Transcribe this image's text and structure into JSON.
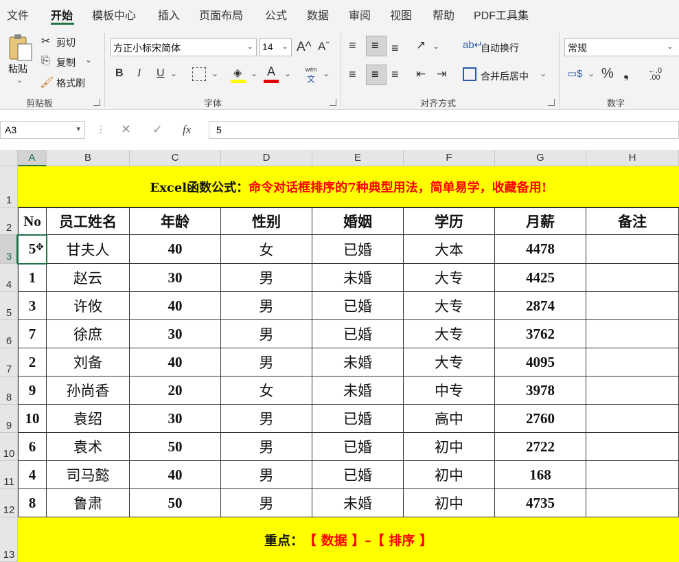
{
  "menu": {
    "tabs": [
      "文件",
      "开始",
      "模板中心",
      "插入",
      "页面布局",
      "公式",
      "数据",
      "审阅",
      "视图",
      "帮助",
      "PDF工具集"
    ]
  },
  "clipboard": {
    "paste": "粘贴",
    "cut": "剪切",
    "copy": "复制",
    "format_painter": "格式刷",
    "group": "剪贴板"
  },
  "font": {
    "name": "方正小标宋简体",
    "size": "14",
    "group": "字体",
    "bold": "B",
    "italic": "I",
    "underline": "U",
    "font_color_icon": "A",
    "grow": "A^",
    "shrink": "Aˇ",
    "phonetic_top": "wén",
    "phonetic_bottom": "文"
  },
  "alignment": {
    "wrap_text": "自动换行",
    "merge_center": "合并后居中",
    "group": "对齐方式"
  },
  "number": {
    "format": "常规",
    "percent": "%",
    "comma": "❟",
    "dec_inc": "←.0 .00",
    "dec_dec": ".00 →.0",
    "group": "数字"
  },
  "formula_bar": {
    "name_box": "A3",
    "fx": "fx",
    "value": "5"
  },
  "grid": {
    "columns": [
      "A",
      "B",
      "C",
      "D",
      "E",
      "F",
      "G",
      "H"
    ],
    "rows": [
      "1",
      "2",
      "3",
      "4",
      "5",
      "6",
      "7",
      "8",
      "9",
      "10",
      "11",
      "12",
      "13"
    ],
    "title_black": "Excel函数公式：",
    "title_red": "命令对话框排序的7种典型用法，简单易学，收藏备用!",
    "headers": [
      "No",
      "员工姓名",
      "年龄",
      "性别",
      "婚姻",
      "学历",
      "月薪",
      "备注"
    ],
    "data": [
      [
        "5",
        "甘夫人",
        "40",
        "女",
        "已婚",
        "大本",
        "4478",
        ""
      ],
      [
        "1",
        "赵云",
        "30",
        "男",
        "未婚",
        "大专",
        "4425",
        ""
      ],
      [
        "3",
        "许攸",
        "40",
        "男",
        "已婚",
        "大专",
        "2874",
        ""
      ],
      [
        "7",
        "徐庶",
        "30",
        "男",
        "已婚",
        "大专",
        "3762",
        ""
      ],
      [
        "2",
        "刘备",
        "40",
        "男",
        "未婚",
        "大专",
        "4095",
        ""
      ],
      [
        "9",
        "孙尚香",
        "20",
        "女",
        "未婚",
        "中专",
        "3978",
        ""
      ],
      [
        "10",
        "袁绍",
        "30",
        "男",
        "已婚",
        "高中",
        "2760",
        ""
      ],
      [
        "6",
        "袁术",
        "50",
        "男",
        "已婚",
        "初中",
        "2722",
        ""
      ],
      [
        "4",
        "司马懿",
        "40",
        "男",
        "已婚",
        "初中",
        "168",
        ""
      ],
      [
        "8",
        "鲁肃",
        "50",
        "男",
        "未婚",
        "初中",
        "4735",
        ""
      ]
    ],
    "footer_black": "重点：",
    "footer_red": "【 数据 】–【 排序 】"
  },
  "colors": {
    "accent": "#217346",
    "highlight": "#ffff00",
    "title_red": "#ff0000"
  }
}
